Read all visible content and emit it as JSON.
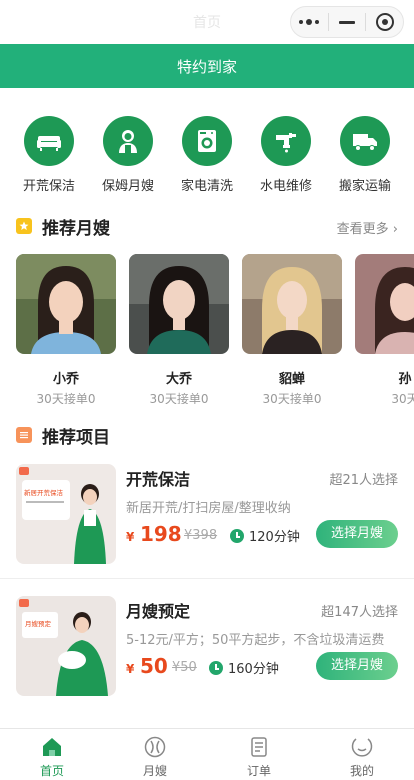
{
  "statusbar": {
    "title": "首页"
  },
  "header": {
    "brand": "特约到家"
  },
  "categories": [
    {
      "label": "开荒保洁",
      "icon": "sofa-icon"
    },
    {
      "label": "保姆月嫂",
      "icon": "nanny-icon"
    },
    {
      "label": "家电清洗",
      "icon": "washing-machine-icon"
    },
    {
      "label": "水电维修",
      "icon": "pipe-icon"
    },
    {
      "label": "搬家运输",
      "icon": "truck-icon"
    }
  ],
  "nanny_section": {
    "title": "推荐月嫂",
    "more": "查看更多"
  },
  "nannies": [
    {
      "name": "小乔",
      "stat": "30天接单0"
    },
    {
      "name": "大乔",
      "stat": "30天接单0"
    },
    {
      "name": "貂蝉",
      "stat": "30天接单0"
    },
    {
      "name": "孙",
      "stat": "30天"
    }
  ],
  "project_section": {
    "title": "推荐项目"
  },
  "projects": [
    {
      "title": "开荒保洁",
      "sold": "超21人选择",
      "desc": "新居开荒/打扫房屋/整理收纳",
      "currency": "¥",
      "price": "198",
      "orig": "¥398",
      "duration": "120分钟",
      "cta": "选择月嫂",
      "thumb_text": "新居开荒保洁"
    },
    {
      "title": "月嫂预定",
      "sold": "超147人选择",
      "desc": "5-12元/平方；50平方起步，不含垃圾清运费",
      "currency": "¥",
      "price": "50",
      "orig": "¥50",
      "duration": "160分钟",
      "cta": "选择月嫂",
      "thumb_text": "月嫂预定"
    }
  ],
  "tabbar": [
    {
      "label": "首页",
      "icon": "home-icon",
      "active": true
    },
    {
      "label": "月嫂",
      "icon": "nanny-tab-icon",
      "active": false
    },
    {
      "label": "订单",
      "icon": "order-icon",
      "active": false
    },
    {
      "label": "我的",
      "icon": "profile-icon",
      "active": false
    }
  ],
  "colors": {
    "brand_green": "#22b07a",
    "icon_green": "#1e9955",
    "price_red": "#e8491d"
  }
}
